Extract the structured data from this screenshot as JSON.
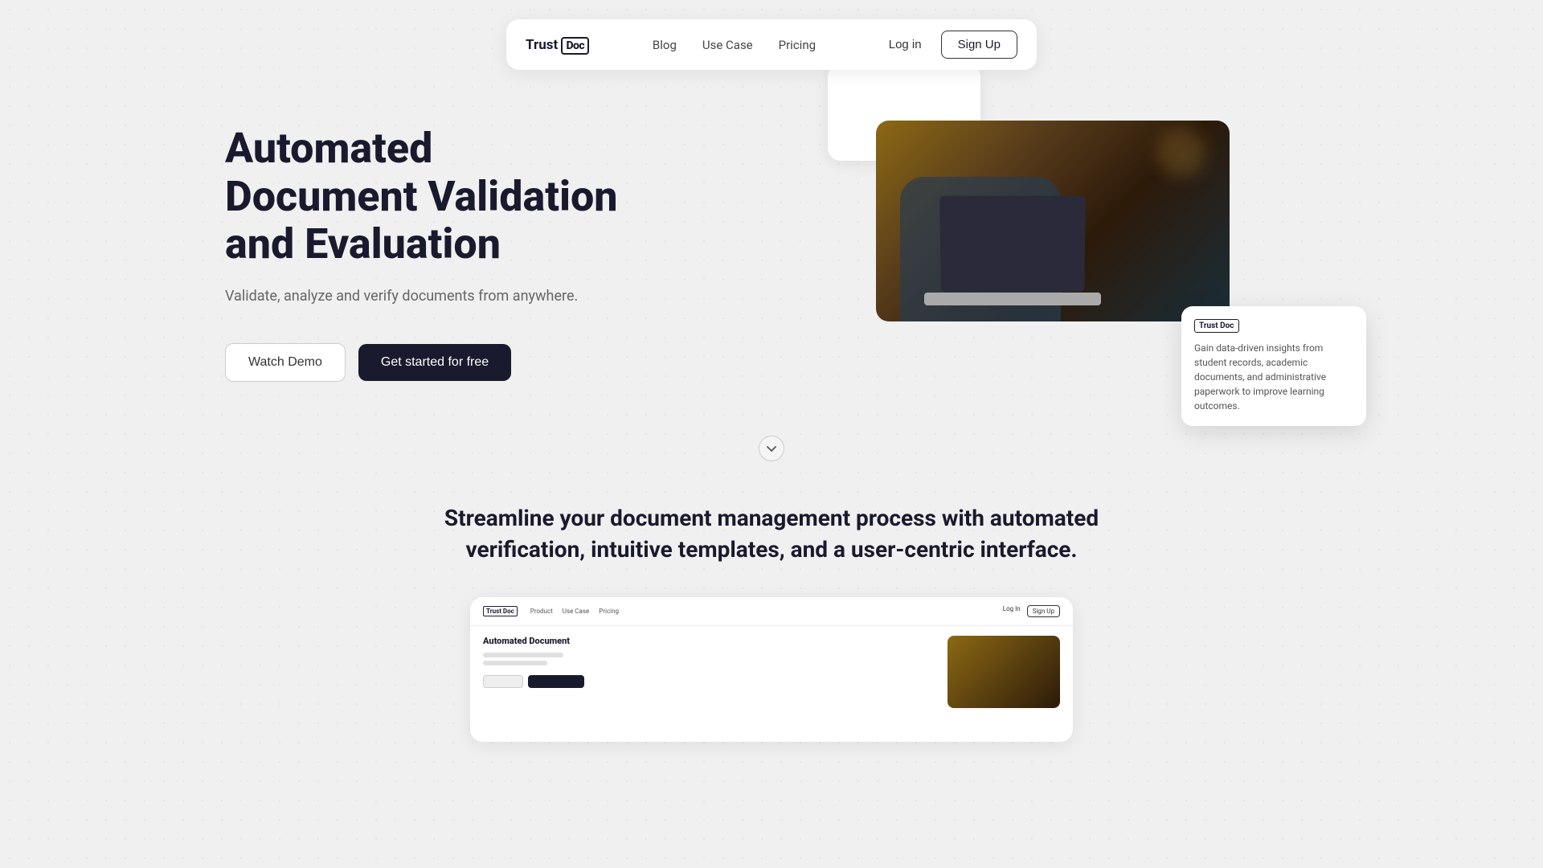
{
  "nav": {
    "logo": {
      "prefix": "Trust",
      "suffix": "Doc"
    },
    "links": [
      {
        "label": "Blog",
        "href": "#"
      },
      {
        "label": "Use Case",
        "href": "#"
      },
      {
        "label": "Pricing",
        "href": "#"
      }
    ],
    "login_label": "Log in",
    "signup_label": "Sign Up"
  },
  "hero": {
    "title": "Automated Document Validation and Evaluation",
    "subtitle": "Validate, analyze and verify documents from anywhere.",
    "btn_demo": "Watch Demo",
    "btn_start": "Get started for free"
  },
  "info_card": {
    "logo": "Trust Doc",
    "text": "Gain data-driven insights from student records, academic documents, and administrative paperwork to improve learning outcomes."
  },
  "scroll": {
    "icon": "chevron-down"
  },
  "second_section": {
    "title": "Streamline your document management process with automated verification, intuitive templates, and a user-centric interface.",
    "preview": {
      "nav": {
        "logo": "Trust Doc",
        "links": [
          "Product",
          "Use Case",
          "Pricing"
        ],
        "login": "Log In",
        "signup": "Sign Up"
      },
      "hero_title": "Automated Document"
    }
  }
}
